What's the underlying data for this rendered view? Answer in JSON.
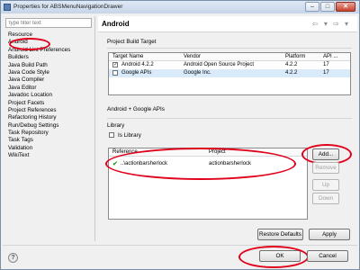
{
  "window": {
    "title": "Properties for ABSMenuNavigationDrawer"
  },
  "filter": {
    "placeholder": "type filter text"
  },
  "tree": [
    "Resource",
    "Android",
    "Android Lint Preferences",
    "Builders",
    "Java Build Path",
    "Java Code Style",
    "Java Compiler",
    "Java Editor",
    "Javadoc Location",
    "Project Facets",
    "Project References",
    "Refactoring History",
    "Run/Debug Settings",
    "Task Repository",
    "Task Tags",
    "Validation",
    "WikiText"
  ],
  "page": {
    "title": "Android"
  },
  "build_target": {
    "section_label": "Project Build Target",
    "columns": [
      "Target Name",
      "Vendor",
      "Platform",
      "API ..."
    ],
    "rows": [
      {
        "checked": true,
        "name": "Android 4.2.2",
        "vendor": "Android Open Source Project",
        "platform": "4.2.2",
        "api": "17"
      },
      {
        "checked": false,
        "name": "Google APIs",
        "vendor": "Google Inc.",
        "platform": "4.2.2",
        "api": "17"
      }
    ],
    "selected_summary": "Android + Google APIs"
  },
  "library": {
    "section_label": "Library",
    "is_library_label": "Is Library",
    "is_library_checked": false,
    "columns": [
      "Reference",
      "Project"
    ],
    "rows": [
      {
        "reference": "..\\actionbarsherlock",
        "project": "actionbarsherlock"
      }
    ],
    "buttons": {
      "add": "Add...",
      "remove": "Remove",
      "up": "Up",
      "down": "Down"
    }
  },
  "footer": {
    "restore_defaults": "Restore Defaults",
    "apply": "Apply",
    "ok": "OK",
    "cancel": "Cancel"
  },
  "colors": {
    "annotation": "#e0001a",
    "selection": "#d9ebfa",
    "check": "#2a9b2a"
  }
}
